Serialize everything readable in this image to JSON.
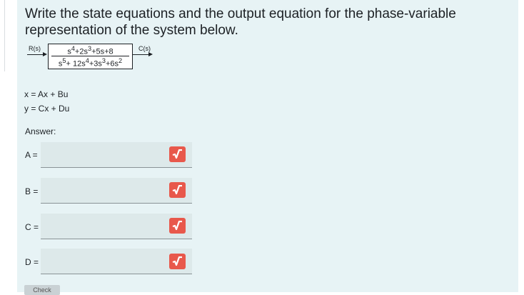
{
  "question": {
    "text": "Write the state equations and the output equation for the phase-variable representation of the system below."
  },
  "block_diagram": {
    "input_label": "R(s)",
    "output_label": "C(s)",
    "numerator_html": "s<sup>4</sup>+2s<sup>3</sup>+5s+8",
    "denominator_html": "s<sup>5</sup>+ 12s<sup>4</sup>+3s<sup>3</sup>+6s<sup>2</sup>"
  },
  "equations": {
    "state_eq": "x = Ax + Bu",
    "output_eq": "y = Cx + Du"
  },
  "answer_label": "Answer:",
  "fields": [
    {
      "label": "A =",
      "value": "",
      "button_icon": "sqrt-icon"
    },
    {
      "label": "B =",
      "value": "",
      "button_icon": "sqrt-icon"
    },
    {
      "label": "C =",
      "value": "",
      "button_icon": "sqrt-icon"
    },
    {
      "label": "D =",
      "value": "",
      "button_icon": "sqrt-icon"
    }
  ],
  "check_button": {
    "label": "Check"
  },
  "colors": {
    "panel_bg": "#e7f3f5",
    "field_bg": "#dde9ea",
    "button_red": "#e8584b"
  }
}
